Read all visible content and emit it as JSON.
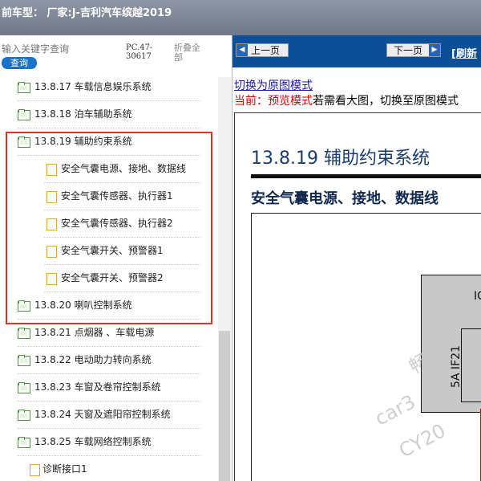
{
  "title_bar": {
    "text": "前车型： 厂家:J-吉利汽车缤越2019"
  },
  "left_panel": {
    "search": {
      "placeholder": "输入关键字查询",
      "button_label": "查询"
    },
    "pc_code": "PC.47-30617",
    "collapse_all_label": "折叠全部",
    "tree_items": [
      {
        "label": "13.8.17 车载信息娱乐系统",
        "type": "folder"
      },
      {
        "label": "13.8.18 泊车辅助系统",
        "type": "folder"
      },
      {
        "label": "13.8.19 辅助约束系统",
        "type": "folder-open"
      },
      {
        "label": "安全气囊电源、接地、数据线",
        "type": "doc"
      },
      {
        "label": "安全气囊传感器、执行器1",
        "type": "doc"
      },
      {
        "label": "安全气囊传感器、执行器2",
        "type": "doc"
      },
      {
        "label": "安全气囊开关、预警器1",
        "type": "doc"
      },
      {
        "label": "安全气囊开关、预警器2",
        "type": "doc"
      },
      {
        "label": "13.8.20 喇叭控制系统",
        "type": "folder"
      },
      {
        "label": "13.8.21 点烟器 、车载电源",
        "type": "folder"
      },
      {
        "label": "13.8.22 电动助力转向系统",
        "type": "folder"
      },
      {
        "label": "13.8.23 车窗及卷帘控制系统",
        "type": "folder"
      },
      {
        "label": "13.8.24 天窗及遮阳帘控制系统",
        "type": "folder"
      },
      {
        "label": "13.8.25 车载网络控制系统",
        "type": "folder-open"
      },
      {
        "label": "诊断接口1",
        "type": "doc"
      }
    ]
  },
  "right_panel": {
    "nav": {
      "prev_label": "上一页",
      "next_label": "下一页",
      "refresh_label": "[刷新"
    },
    "switch_link": "切换为原图模式",
    "status_prefix": "当前：预览模式",
    "status_text": "若需看大图，切换至原图模式",
    "document": {
      "title": "13.8.19 辅助约束系统",
      "subtitle": "安全气囊电源、接地、数据线",
      "gray_block_label": "IC",
      "fuse_label": "5A IF21",
      "watermarks": [
        "畅",
        "car3",
        "CY20"
      ]
    }
  },
  "colors": {
    "nav_bar": "#0d4f96",
    "highlight_border": "#d9342b",
    "search_button": "#1a73c9",
    "folder_icon": "#4c9a3f",
    "doc_icon": "#e3a341"
  }
}
